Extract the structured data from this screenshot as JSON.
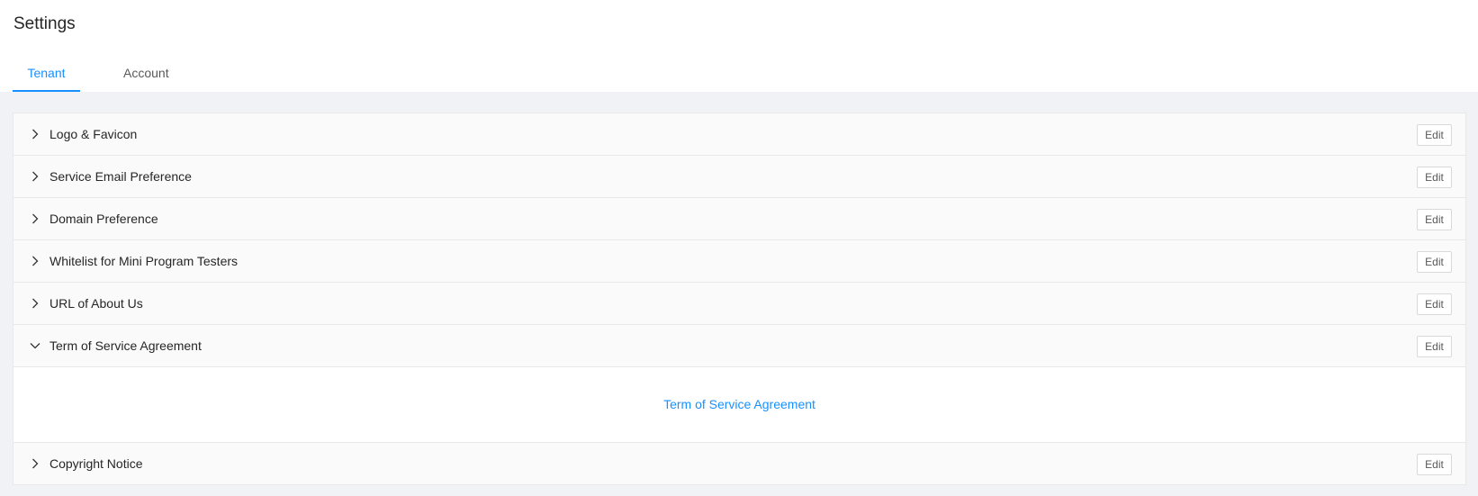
{
  "page": {
    "title": "Settings"
  },
  "tabs": [
    {
      "label": "Tenant",
      "active": true
    },
    {
      "label": "Account",
      "active": false
    }
  ],
  "theme": {
    "accent": "#1890ff",
    "background": "#f0f2f5",
    "row_background": "#fafafa",
    "border": "#e8e8e8"
  },
  "sections": [
    {
      "title": "Logo & Favicon",
      "expanded": false,
      "edit_label": "Edit",
      "icon": "chevron-right-icon"
    },
    {
      "title": "Service Email Preference",
      "expanded": false,
      "edit_label": "Edit",
      "icon": "chevron-right-icon"
    },
    {
      "title": "Domain Preference",
      "expanded": false,
      "edit_label": "Edit",
      "icon": "chevron-right-icon"
    },
    {
      "title": "Whitelist for Mini Program Testers",
      "expanded": false,
      "edit_label": "Edit",
      "icon": "chevron-right-icon"
    },
    {
      "title": "URL of About Us",
      "expanded": false,
      "edit_label": "Edit",
      "icon": "chevron-right-icon"
    },
    {
      "title": "Term of Service Agreement",
      "expanded": true,
      "edit_label": "Edit",
      "icon": "chevron-down-icon",
      "content_link": "Term of Service Agreement"
    },
    {
      "title": "Copyright Notice",
      "expanded": false,
      "edit_label": "Edit",
      "icon": "chevron-right-icon"
    }
  ]
}
